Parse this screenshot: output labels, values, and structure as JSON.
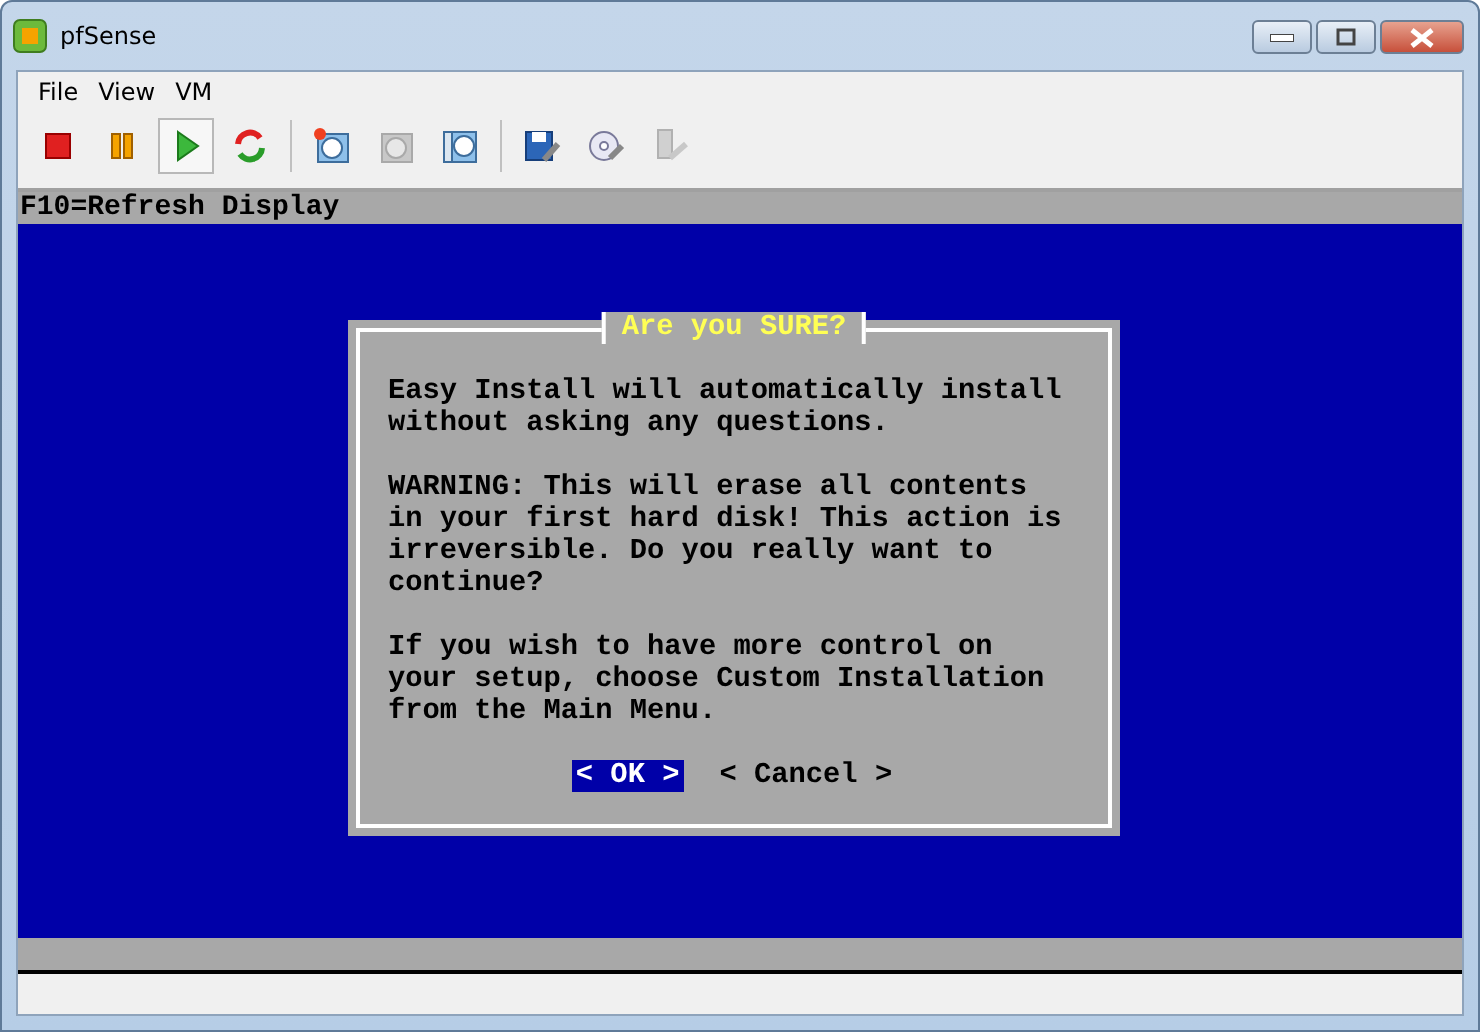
{
  "window": {
    "title": "pfSense"
  },
  "menu": [
    "File",
    "View",
    "VM"
  ],
  "toolbar": [
    {
      "kind": "stop",
      "selected": false,
      "disabled": false
    },
    {
      "kind": "pause",
      "selected": false,
      "disabled": false
    },
    {
      "kind": "play",
      "selected": true,
      "disabled": false
    },
    {
      "kind": "reset",
      "selected": false,
      "disabled": false
    },
    {
      "kind": "sep"
    },
    {
      "kind": "snapshot",
      "selected": false,
      "disabled": false
    },
    {
      "kind": "revert",
      "selected": false,
      "disabled": true
    },
    {
      "kind": "manage",
      "selected": false,
      "disabled": false
    },
    {
      "kind": "sep"
    },
    {
      "kind": "settings",
      "selected": false,
      "disabled": false
    },
    {
      "kind": "cd",
      "selected": false,
      "disabled": false
    },
    {
      "kind": "usb",
      "selected": false,
      "disabled": true
    }
  ],
  "console": {
    "header": "F10=Refresh Display",
    "dialog": {
      "title": "Are you SURE?",
      "paragraphs": [
        [
          "Easy Install will automatically install",
          "without asking any questions."
        ],
        [
          "WARNING: This will erase all contents",
          "in your first hard disk! This action is",
          "irreversible. Do you really want to",
          "continue?"
        ],
        [
          "If you wish to have more control on",
          "your setup, choose Custom Installation",
          "from the Main Menu."
        ]
      ],
      "buttons": [
        {
          "label": "< OK >",
          "selected": true
        },
        {
          "label": "< Cancel >",
          "selected": false
        }
      ]
    }
  }
}
